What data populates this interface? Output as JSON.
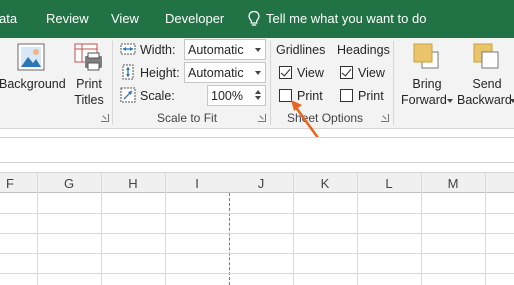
{
  "tabs": [
    "ata",
    "Review",
    "View",
    "Developer"
  ],
  "tell_me": "Tell me what you want to do",
  "ribbon": {
    "background_label": "Background",
    "print_titles_line1": "Print",
    "print_titles_line2": "Titles",
    "scale_to_fit": {
      "width_label": "Width:",
      "width_value": "Automatic",
      "height_label": "Height:",
      "height_value": "Automatic",
      "scale_label": "Scale:",
      "scale_value": "100%",
      "group_label": "Scale to Fit"
    },
    "sheet_options": {
      "gridlines_header": "Gridlines",
      "headings_header": "Headings",
      "gridlines_view_label": "View",
      "gridlines_print_label": "Print",
      "headings_view_label": "View",
      "headings_print_label": "Print",
      "gridlines_view_checked": true,
      "gridlines_print_checked": false,
      "headings_view_checked": true,
      "headings_print_checked": false,
      "group_label": "Sheet Options"
    },
    "arrange": {
      "bring_forward_line1": "Bring",
      "bring_forward_line2": "Forward",
      "send_backward_line1": "Send",
      "send_backward_line2": "Backward"
    }
  },
  "columns": [
    "F",
    "G",
    "H",
    "I",
    "J",
    "K",
    "L",
    "M"
  ],
  "colors": {
    "tabbar": "#217346",
    "ribbon": "#f3f3f3",
    "arrow": "#e8641f"
  }
}
